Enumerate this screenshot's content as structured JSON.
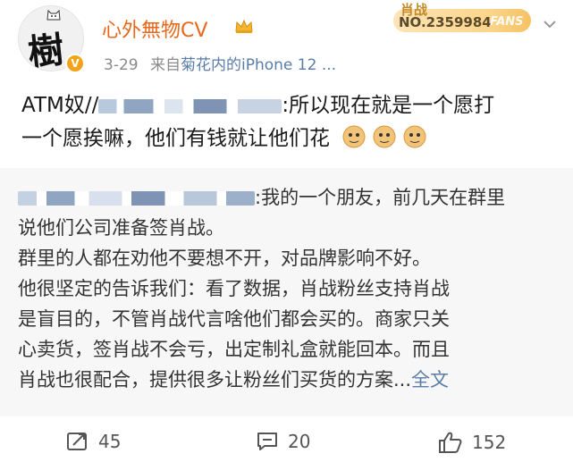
{
  "post": {
    "username": "心外無物CV",
    "date": "3-29",
    "source_prefix": "来自",
    "source": "菊花内的iPhone 12 ...",
    "fans_tag": "肖战",
    "fans_number": "NO.2359984",
    "fans_word": "FANS",
    "text_prefix": "ATM奴//",
    "text_part": ":所以现在就是一个愿打",
    "text_line2": "一个愿挨嘛，他们有钱就让他们花",
    "avatar_char": "樹",
    "verified": "V"
  },
  "repost": {
    "line1": ":我的一个朋友，前几天在群里",
    "line2": "说他们公司准备签肖战。",
    "line3": "群里的人都在劝他不要想不开，对品牌影响不好。",
    "line4": "他很坚定的告诉我们：看了数据，肖战粉丝支持肖战",
    "line5": "是盲目的，不管肖战代言啥他们都会买的。商家只关",
    "line6": "心卖货，签肖战不会亏，出定制礼盒就能回本。而且",
    "line7": "肖战也很配合，提供很多让粉丝们买货的方案...",
    "more": "全文"
  },
  "actions": {
    "repost_count": "45",
    "comment_count": "20",
    "like_count": "152"
  },
  "colors": {
    "username": "#e8671a",
    "link": "#5a7da8",
    "repost_bg": "#f7f7f7",
    "fans_gold": "#f6c264"
  },
  "icons": [
    "crown-icon",
    "chevron-down-icon",
    "doge-emoji-icon",
    "repost-icon",
    "comment-icon",
    "like-icon",
    "verified-badge-icon"
  ]
}
